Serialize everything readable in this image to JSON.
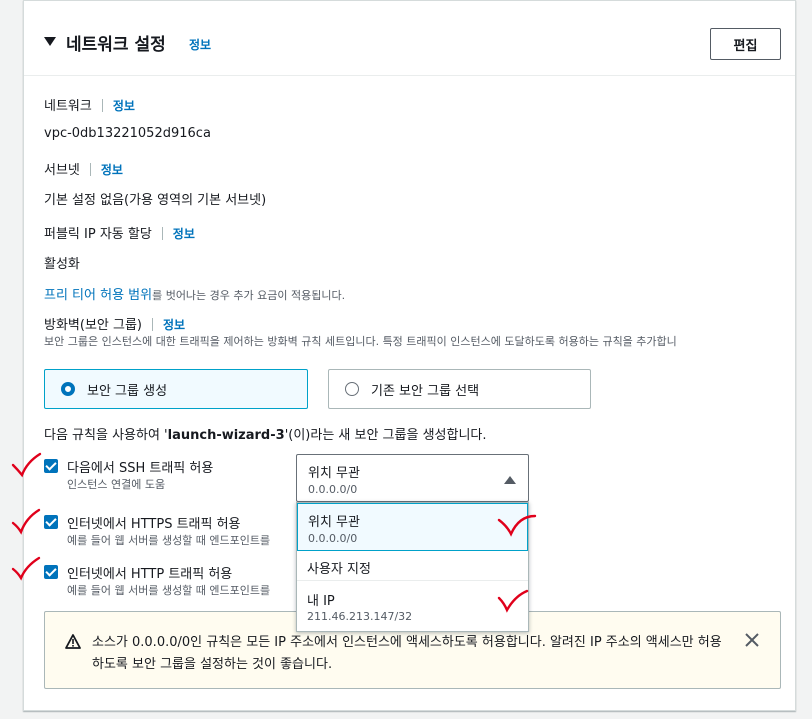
{
  "header": {
    "title": "네트워크 설정",
    "info_link": "정보",
    "edit_button": "편집"
  },
  "network": {
    "label": "네트워크",
    "info": "정보",
    "value": "vpc-0db13221052d916ca"
  },
  "subnet": {
    "label": "서브넷",
    "info": "정보",
    "value": "기본 설정 없음(가용 영역의 기본 서브넷)"
  },
  "public_ip": {
    "label": "퍼블릭 IP 자동 할당",
    "info": "정보",
    "value": "활성화",
    "free_tier_link": "프리 티어 허용 범위",
    "free_tier_text": "를 벗어나는 경우 추가 요금이 적용됩니다."
  },
  "firewall": {
    "label": "방화벽(보안 그룹)",
    "info": "정보",
    "description": "보안 그룹은 인스턴스에 대한 트래픽을 제어하는 방화벽 규칙 세트입니다. 특정 트래픽이 인스턴스에 도달하도록 허용하는 규칙을 추가합니",
    "options": [
      {
        "label": "보안 그룹 생성",
        "selected": true
      },
      {
        "label": "기존 보안 그룹 선택",
        "selected": false
      }
    ],
    "rule_intro_prefix": "다음 규칙을 사용하여 '",
    "rule_intro_name": "launch-wizard-3",
    "rule_intro_suffix": "'(이)라는 새 보안 그룹을 생성합니다."
  },
  "rules": [
    {
      "label": "다음에서 SSH 트래픽 허용",
      "sub": "인스턴스 연결에 도움",
      "checked": true
    },
    {
      "label": "인터넷에서 HTTPS 트래픽 허용",
      "sub": "예를 들어 웹 서버를 생성할 때 엔드포인트를",
      "checked": true
    },
    {
      "label": "인터넷에서 HTTP 트래픽 허용",
      "sub": "예를 들어 웹 서버를 생성할 때 엔드포인트를",
      "checked": true
    }
  ],
  "ssh_source_select": {
    "value": "위치 무관",
    "sub": "0.0.0.0/0",
    "options": [
      {
        "label": "위치 무관",
        "sub": "0.0.0.0/0",
        "highlighted": true
      },
      {
        "label": "사용자 지정",
        "sub": ""
      },
      {
        "label": "내 IP",
        "sub": "211.46.213.147/32"
      }
    ]
  },
  "alert": {
    "text": "소스가 0.0.0.0/0인 규칙은 모든 IP 주소에서 인스턴스에 액세스하도록 허용합니다. 알려진 IP 주소의 액세스만 허용하도록 보안 그룹을 설정하는 것이 좋습니다."
  },
  "colors": {
    "link": "#0073bb",
    "selected_border": "#00a1c9",
    "checkbox": "#0073bb",
    "warning_bg": "#fffcf0",
    "annotation_red": "#e0001b"
  }
}
